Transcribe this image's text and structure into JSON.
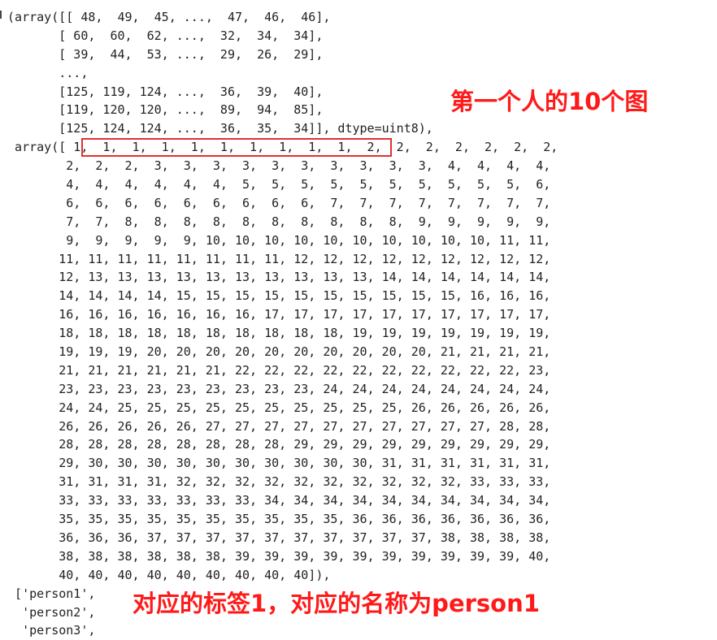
{
  "output_lines": [
    " (array([[ 48,  49,  45, ...,  47,  46,  46],",
    "        [ 60,  60,  62, ...,  32,  34,  34],",
    "        [ 39,  44,  53, ...,  29,  26,  29],",
    "        ...,",
    "        [125, 119, 124, ...,  36,  39,  40],",
    "        [119, 120, 120, ...,  89,  94,  85],",
    "        [125, 124, 124, ...,  36,  35,  34]], dtype=uint8),",
    "  array([ 1,  1,  1,  1,  1,  1,  1,  1,  1,  1,  2,  2,  2,  2,  2,  2,  2,",
    "         2,  2,  2,  3,  3,  3,  3,  3,  3,  3,  3,  3,  3,  4,  4,  4,  4,",
    "         4,  4,  4,  4,  4,  4,  5,  5,  5,  5,  5,  5,  5,  5,  5,  5,  6,",
    "         6,  6,  6,  6,  6,  6,  6,  6,  6,  7,  7,  7,  7,  7,  7,  7,  7,",
    "         7,  7,  8,  8,  8,  8,  8,  8,  8,  8,  8,  8,  9,  9,  9,  9,  9,",
    "         9,  9,  9,  9,  9, 10, 10, 10, 10, 10, 10, 10, 10, 10, 10, 11, 11,",
    "        11, 11, 11, 11, 11, 11, 11, 11, 12, 12, 12, 12, 12, 12, 12, 12, 12,",
    "        12, 13, 13, 13, 13, 13, 13, 13, 13, 13, 13, 14, 14, 14, 14, 14, 14,",
    "        14, 14, 14, 14, 15, 15, 15, 15, 15, 15, 15, 15, 15, 15, 16, 16, 16,",
    "        16, 16, 16, 16, 16, 16, 16, 17, 17, 17, 17, 17, 17, 17, 17, 17, 17,",
    "        18, 18, 18, 18, 18, 18, 18, 18, 18, 18, 19, 19, 19, 19, 19, 19, 19,",
    "        19, 19, 19, 20, 20, 20, 20, 20, 20, 20, 20, 20, 20, 21, 21, 21, 21,",
    "        21, 21, 21, 21, 21, 21, 22, 22, 22, 22, 22, 22, 22, 22, 22, 22, 23,",
    "        23, 23, 23, 23, 23, 23, 23, 23, 23, 24, 24, 24, 24, 24, 24, 24, 24,",
    "        24, 24, 25, 25, 25, 25, 25, 25, 25, 25, 25, 25, 26, 26, 26, 26, 26,",
    "        26, 26, 26, 26, 26, 27, 27, 27, 27, 27, 27, 27, 27, 27, 27, 28, 28,",
    "        28, 28, 28, 28, 28, 28, 28, 28, 29, 29, 29, 29, 29, 29, 29, 29, 29,",
    "        29, 30, 30, 30, 30, 30, 30, 30, 30, 30, 30, 31, 31, 31, 31, 31, 31,",
    "        31, 31, 31, 31, 32, 32, 32, 32, 32, 32, 32, 32, 32, 32, 33, 33, 33,",
    "        33, 33, 33, 33, 33, 33, 33, 34, 34, 34, 34, 34, 34, 34, 34, 34, 34,",
    "        35, 35, 35, 35, 35, 35, 35, 35, 35, 35, 36, 36, 36, 36, 36, 36, 36,",
    "        36, 36, 36, 37, 37, 37, 37, 37, 37, 37, 37, 37, 37, 38, 38, 38, 38,",
    "        38, 38, 38, 38, 38, 38, 39, 39, 39, 39, 39, 39, 39, 39, 39, 39, 40,",
    "        40, 40, 40, 40, 40, 40, 40, 40, 40]),",
    "  ['person1',",
    "   'person2',",
    "   'person3',"
  ],
  "annotations": {
    "first_person_images": "第一个人的10个图",
    "label_and_name": "对应的标签1，对应的名称为person1"
  },
  "colors": {
    "annotation_red": "#ff1a1a",
    "box_red": "#e03131",
    "code_text": "#222222"
  }
}
